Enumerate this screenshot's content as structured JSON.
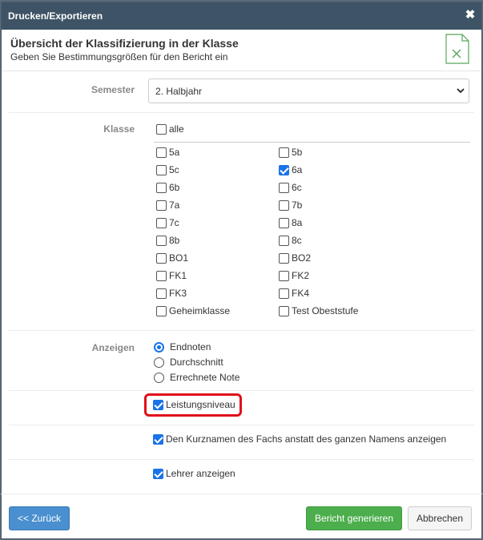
{
  "dialog": {
    "title": "Drucken/Exportieren",
    "close_label": "✖",
    "heading": "Übersicht der Klassifizierung in der Klasse",
    "subheading": "Geben Sie Bestimmungsgrößen für den Bericht ein"
  },
  "semester": {
    "label": "Semester",
    "value": "2. Halbjahr",
    "options": [
      "2. Halbjahr"
    ]
  },
  "klasse": {
    "label": "Klasse",
    "all_label": "alle",
    "all_checked": false,
    "left": [
      {
        "label": "5a",
        "checked": false
      },
      {
        "label": "5c",
        "checked": false
      },
      {
        "label": "6b",
        "checked": false
      },
      {
        "label": "7a",
        "checked": false
      },
      {
        "label": "7c",
        "checked": false
      },
      {
        "label": "8b",
        "checked": false
      },
      {
        "label": "BO1",
        "checked": false
      },
      {
        "label": "FK1",
        "checked": false
      },
      {
        "label": "FK3",
        "checked": false
      },
      {
        "label": "Geheimklasse",
        "checked": false
      }
    ],
    "right": [
      {
        "label": "5b",
        "checked": false
      },
      {
        "label": "6a",
        "checked": true
      },
      {
        "label": "6c",
        "checked": false
      },
      {
        "label": "7b",
        "checked": false
      },
      {
        "label": "8a",
        "checked": false
      },
      {
        "label": "8c",
        "checked": false
      },
      {
        "label": "BO2",
        "checked": false
      },
      {
        "label": "FK2",
        "checked": false
      },
      {
        "label": "FK4",
        "checked": false
      },
      {
        "label": "Test Obeststufe",
        "checked": false
      }
    ]
  },
  "anzeigen": {
    "label": "Anzeigen",
    "options": [
      {
        "label": "Endnoten",
        "selected": true
      },
      {
        "label": "Durchschnitt",
        "selected": false
      },
      {
        "label": "Errechnete Note",
        "selected": false
      }
    ]
  },
  "options": {
    "leistungsniveau": {
      "label": "Leistungsniveau",
      "checked": true
    },
    "kurznamen": {
      "label": "Den Kurznamen des Fachs anstatt des ganzen Namens anzeigen",
      "checked": true
    },
    "lehrer": {
      "label": "Lehrer anzeigen",
      "checked": true
    }
  },
  "buttons": {
    "back": "<< Zurück",
    "generate": "Bericht generieren",
    "cancel": "Abbrechen"
  },
  "colors": {
    "titlebar": "#3e5466",
    "primary": "#4a8fcf",
    "success": "#4cae4c",
    "highlight": "#e0101a",
    "checkbox": "#1a73e8"
  }
}
